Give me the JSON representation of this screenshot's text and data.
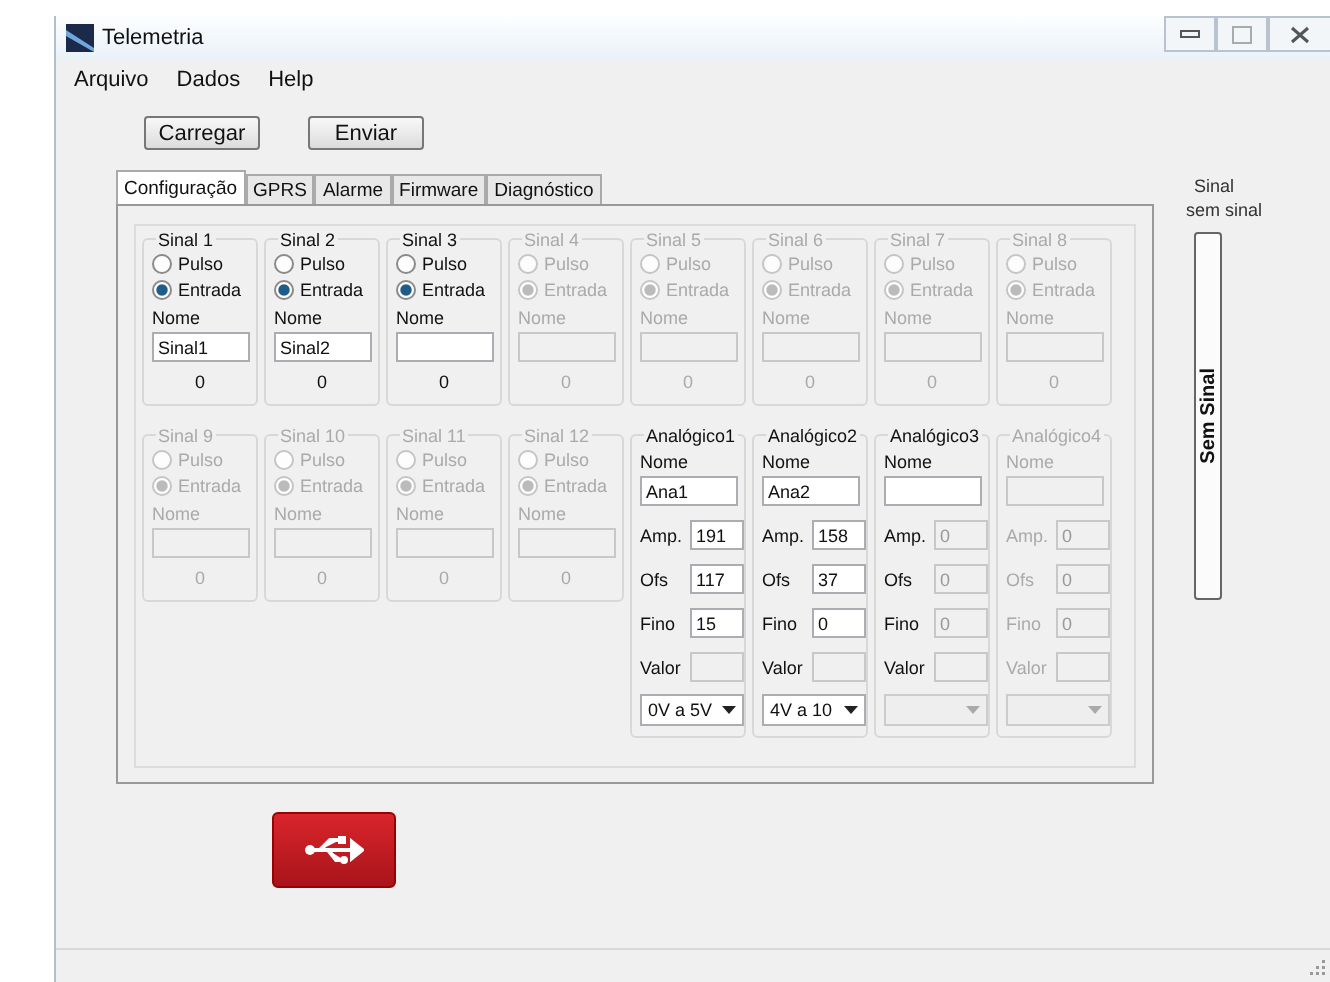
{
  "window": {
    "title": "Telemetria"
  },
  "menu": [
    "Arquivo",
    "Dados",
    "Help"
  ],
  "buttons": [
    "Carregar",
    "Enviar"
  ],
  "tabs": [
    {
      "label": "Configuração",
      "selected": true
    },
    {
      "label": "GPRS",
      "selected": false
    },
    {
      "label": "Alarme",
      "selected": false
    },
    {
      "label": "Firmware",
      "selected": false
    },
    {
      "label": "Diagnóstico",
      "selected": false
    }
  ],
  "signals": [
    {
      "label": "Sinal 1",
      "enabled": true,
      "options": [
        {
          "label": "Pulso",
          "selected": false
        },
        {
          "label": "Entrada",
          "selected": true
        }
      ],
      "name_label": "Nome",
      "name": "Sinal1",
      "reading": "0"
    },
    {
      "label": "Sinal 2",
      "enabled": true,
      "options": [
        {
          "label": "Pulso",
          "selected": false
        },
        {
          "label": "Entrada",
          "selected": true
        }
      ],
      "name_label": "Nome",
      "name": "Sinal2",
      "reading": "0"
    },
    {
      "label": "Sinal 3",
      "enabled": true,
      "options": [
        {
          "label": "Pulso",
          "selected": false
        },
        {
          "label": "Entrada",
          "selected": true
        }
      ],
      "name_label": "Nome",
      "reading": "0"
    },
    {
      "label": "Sinal 4",
      "enabled": false,
      "options": [
        {
          "label": "Pulso",
          "selected": false
        },
        {
          "label": "Entrada",
          "selected": true
        }
      ],
      "name_label": "Nome",
      "reading": "0"
    },
    {
      "label": "Sinal 5",
      "enabled": false,
      "options": [
        {
          "label": "Pulso",
          "selected": false
        },
        {
          "label": "Entrada",
          "selected": true
        }
      ],
      "name_label": "Nome",
      "reading": "0"
    },
    {
      "label": "Sinal 6",
      "enabled": false,
      "options": [
        {
          "label": "Pulso",
          "selected": false
        },
        {
          "label": "Entrada",
          "selected": true
        }
      ],
      "name_label": "Nome",
      "reading": "0"
    },
    {
      "label": "Sinal 7",
      "enabled": false,
      "options": [
        {
          "label": "Pulso",
          "selected": false
        },
        {
          "label": "Entrada",
          "selected": true
        }
      ],
      "name_label": "Nome",
      "reading": "0"
    },
    {
      "label": "Sinal 8",
      "enabled": false,
      "options": [
        {
          "label": "Pulso",
          "selected": false
        },
        {
          "label": "Entrada",
          "selected": true
        }
      ],
      "name_label": "Nome",
      "reading": "0"
    },
    {
      "label": "Sinal 9",
      "enabled": false,
      "options": [
        {
          "label": "Pulso",
          "selected": false
        },
        {
          "label": "Entrada",
          "selected": true
        }
      ],
      "name_label": "Nome",
      "reading": "0"
    },
    {
      "label": "Sinal 10",
      "enabled": false,
      "options": [
        {
          "label": "Pulso",
          "selected": false
        },
        {
          "label": "Entrada",
          "selected": true
        }
      ],
      "name_label": "Nome",
      "reading": "0"
    },
    {
      "label": "Sinal 11",
      "enabled": false,
      "options": [
        {
          "label": "Pulso",
          "selected": false
        },
        {
          "label": "Entrada",
          "selected": true
        }
      ],
      "name_label": "Nome",
      "reading": "0"
    },
    {
      "label": "Sinal 12",
      "enabled": false,
      "options": [
        {
          "label": "Pulso",
          "selected": false
        },
        {
          "label": "Entrada",
          "selected": true
        }
      ],
      "name_label": "Nome",
      "reading": "0"
    }
  ],
  "analogs": [
    {
      "label": "Analógico1",
      "enabled": true,
      "name_label": "Nome",
      "name": "Ana1",
      "fields": [
        {
          "label": "Amp.",
          "value": "191",
          "disabled": false
        },
        {
          "label": "Ofs",
          "value": "117",
          "disabled": false
        },
        {
          "label": "Fino",
          "value": "15",
          "disabled": false
        },
        {
          "label": "Valor",
          "disabled": true
        }
      ],
      "range": {
        "value": "0V a 5V",
        "disabled": false
      }
    },
    {
      "label": "Analógico2",
      "enabled": true,
      "name_label": "Nome",
      "name": "Ana2",
      "fields": [
        {
          "label": "Amp.",
          "value": "158",
          "disabled": false
        },
        {
          "label": "Ofs",
          "value": "37",
          "disabled": false
        },
        {
          "label": "Fino",
          "value": "0",
          "disabled": false
        },
        {
          "label": "Valor",
          "disabled": true
        }
      ],
      "range": {
        "value": "4V a 10",
        "disabled": false
      }
    },
    {
      "label": "Analógico3",
      "enabled": true,
      "name_label": "Nome",
      "fields": [
        {
          "label": "Amp.",
          "value": "0",
          "disabled": true
        },
        {
          "label": "Ofs",
          "value": "0",
          "disabled": true
        },
        {
          "label": "Fino",
          "value": "0",
          "disabled": true
        },
        {
          "label": "Valor",
          "disabled": true
        }
      ],
      "range": {
        "disabled": true
      }
    },
    {
      "label": "Analógico4",
      "enabled": false,
      "name_label": "Nome",
      "fields": [
        {
          "label": "Amp.",
          "value": "0",
          "disabled": true
        },
        {
          "label": "Ofs",
          "value": "0",
          "disabled": true
        },
        {
          "label": "Fino",
          "value": "0",
          "disabled": true
        },
        {
          "label": "Valor",
          "disabled": true
        }
      ],
      "range": {
        "disabled": true
      }
    }
  ],
  "signal_panel": {
    "title": "Sinal",
    "status": "sem sinal",
    "bar_label": "Sem Sinal"
  }
}
